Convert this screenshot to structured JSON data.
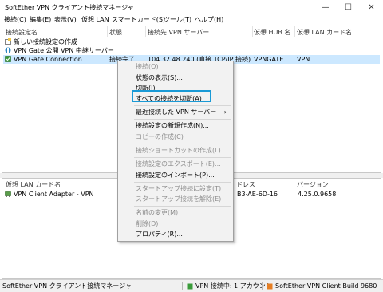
{
  "window": {
    "title": "SoftEther VPN クライアント接続マネージャ",
    "buttons": {
      "minimize": "—",
      "maximize": "☐",
      "close": "✕"
    }
  },
  "menubar": [
    "接続(C)",
    "編集(E)",
    "表示(V)",
    "仮想 LAN",
    "スマートカード(S)",
    "ツール(T)",
    "ヘルプ(H)"
  ],
  "top_pane": {
    "headers": [
      "接続設定名",
      "状態",
      "接続先 VPN サーバー",
      "仮想 HUB 名",
      "仮想 LAN カード名"
    ],
    "rows": [
      {
        "name": "新しい接続設定の作成",
        "status": "",
        "server": "",
        "hub": "",
        "nic": "",
        "selected": false
      },
      {
        "name": "VPN Gate 公開 VPN 中継サーバー",
        "status": "",
        "server": "",
        "hub": "",
        "nic": "",
        "selected": false
      },
      {
        "name": "VPN Gate Connection",
        "status": "接続完了",
        "server": "104.32.48.240 (直接 TCP/IP 接続)",
        "hub": "VPNGATE",
        "nic": "VPN",
        "selected": true
      }
    ]
  },
  "bottom_pane": {
    "headers": [
      "仮想 LAN カード名",
      "ドレス",
      "バージョン"
    ],
    "rows": [
      {
        "name": "VPN Client Adapter - VPN",
        "mac": "B3-AE-6D-16",
        "version": "4.25.0.9658"
      }
    ]
  },
  "context_menu": {
    "items": [
      {
        "label": "接続(O)",
        "disabled": true
      },
      {
        "label": "状態の表示(S)...",
        "disabled": false
      },
      {
        "label": "切断(I)",
        "disabled": false
      },
      {
        "label": "すべての接続を切断(A)",
        "disabled": false,
        "highlighted": true
      },
      {
        "sep": true
      },
      {
        "label": "最近接続した VPN サーバー",
        "disabled": false,
        "submenu": true
      },
      {
        "sep": true
      },
      {
        "label": "接続設定の新規作成(N)...",
        "disabled": false
      },
      {
        "label": "コピーの作成(C)",
        "disabled": true
      },
      {
        "sep": true
      },
      {
        "label": "接続ショートカットの作成(L)...",
        "disabled": true
      },
      {
        "sep": true
      },
      {
        "label": "接続設定のエクスポート(E)...",
        "disabled": true
      },
      {
        "label": "接続設定のインポート(P)...",
        "disabled": false
      },
      {
        "sep": true
      },
      {
        "label": "スタートアップ接続に設定(T)",
        "disabled": true
      },
      {
        "label": "スタートアップ接続を解除(E)",
        "disabled": true
      },
      {
        "sep": true
      },
      {
        "label": "名前の変更(M)",
        "disabled": true
      },
      {
        "label": "削除(D)",
        "disabled": true
      },
      {
        "label": "プロパティ(R)...",
        "disabled": false
      }
    ],
    "submenu_arrow": "›"
  },
  "statusbar": {
    "left": "SoftEther VPN クライアント接続マネージャ",
    "middle": "VPN 接続中: 1 アカウント",
    "right": "SoftEther VPN Client Build 9680"
  },
  "colors": {
    "selection": "#cce8ff",
    "highlight_box": "#1a9ad6"
  }
}
